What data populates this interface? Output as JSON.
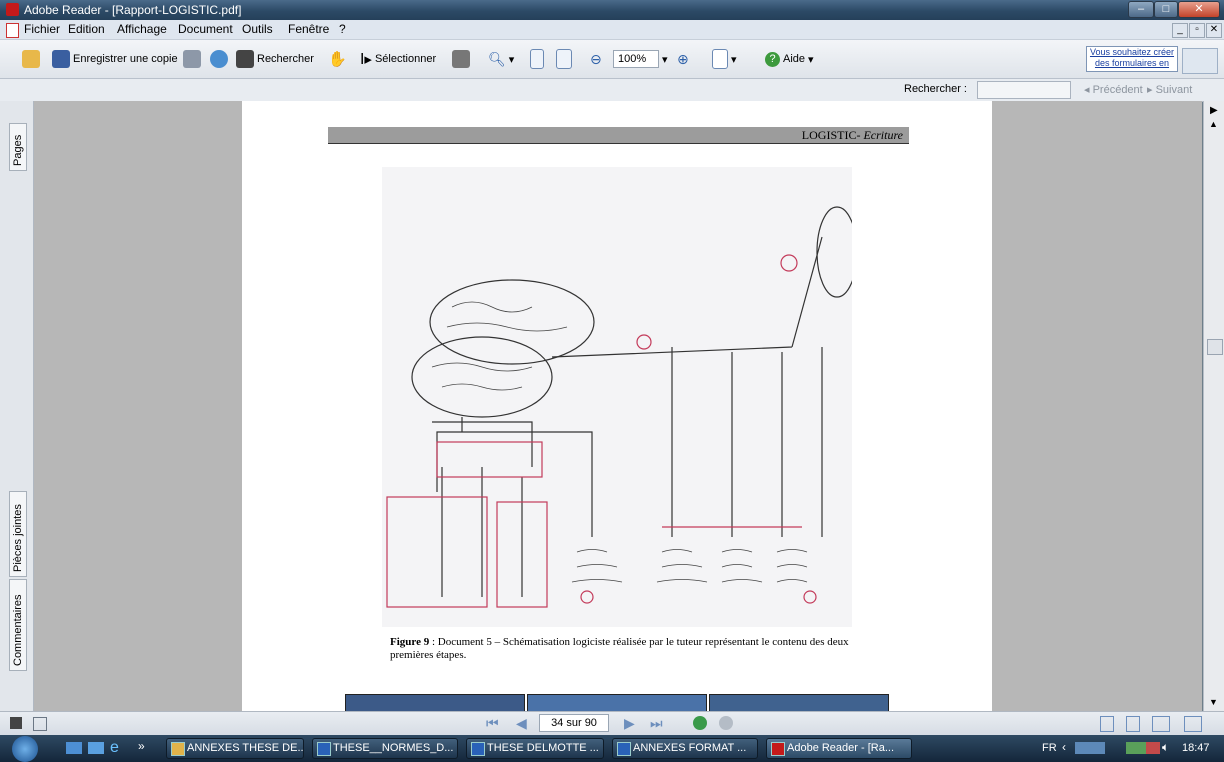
{
  "window": {
    "title": "Adobe Reader - [Rapport-LOGISTIC.pdf]"
  },
  "menu": [
    "Fichier",
    "Edition",
    "Affichage",
    "Document",
    "Outils",
    "Fenêtre",
    "?"
  ],
  "toolbar": {
    "save_copy": "Enregistrer une copie",
    "search": "Rechercher",
    "select": "Sélectionner",
    "zoom": "100%",
    "help": "Aide",
    "forms_promo": "Vous souhaitez créer des formulaires en"
  },
  "find": {
    "label": "Rechercher :",
    "value": "",
    "prev": "Précédent",
    "next": "Suivant"
  },
  "side_tabs": {
    "pages": "Pages",
    "attachments": "Pièces jointes",
    "comments": "Commentaires"
  },
  "document": {
    "header": "LOGISTIC- ",
    "header_em": "Ecriture",
    "caption_bold": "Figure 9",
    "caption": " : Document 5 – Schématisation logiciste réalisée par le tuteur représentant le contenu des deux premières étapes."
  },
  "nav": {
    "page_indicator": "34 sur 90"
  },
  "taskbar": {
    "items": [
      "ANNEXES THESE DE...",
      "THESE__NORMES_D...",
      "THESE DELMOTTE ...",
      "ANNEXES FORMAT ...",
      "Adobe Reader - [Ra..."
    ],
    "lang": "FR",
    "clock": "18:47"
  }
}
